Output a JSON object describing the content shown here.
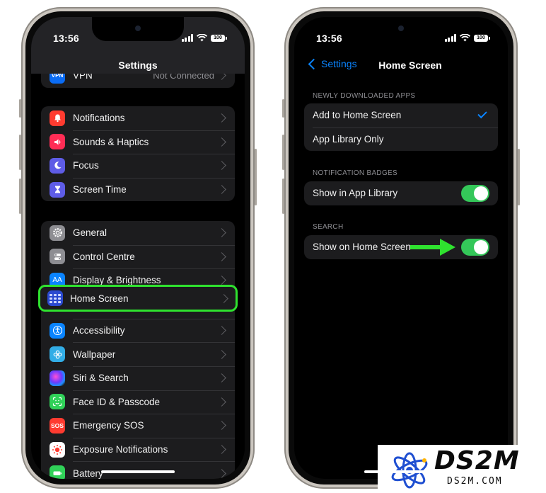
{
  "left_phone": {
    "time": "13:56",
    "battery": "100",
    "title": "Settings",
    "vpn": {
      "label": "VPN",
      "value": "Not Connected"
    },
    "group2": [
      {
        "label": "Notifications",
        "icon": "bell-icon",
        "color": "#ff3b30"
      },
      {
        "label": "Sounds & Haptics",
        "icon": "speaker-icon",
        "color": "#ff2d55"
      },
      {
        "label": "Focus",
        "icon": "moon-icon",
        "color": "#5e5ce6"
      },
      {
        "label": "Screen Time",
        "icon": "hourglass-icon",
        "color": "#5e5ce6"
      }
    ],
    "group3": [
      {
        "label": "General",
        "icon": "gear-icon",
        "color": "#8e8e93"
      },
      {
        "label": "Control Centre",
        "icon": "toggles-icon",
        "color": "#8e8e93"
      },
      {
        "label": "Display & Brightness",
        "icon": "text-size-icon",
        "color": "#0a84ff"
      },
      {
        "label": "Home Screen",
        "icon": "home-grid-icon",
        "color": "#2b4ad0"
      },
      {
        "label": "Accessibility",
        "icon": "accessibility-icon",
        "color": "#0a84ff"
      },
      {
        "label": "Wallpaper",
        "icon": "flower-icon",
        "color": "#32ade6"
      },
      {
        "label": "Siri & Search",
        "icon": "siri-icon",
        "color": "#2c2c2e"
      },
      {
        "label": "Face ID & Passcode",
        "icon": "face-id-icon",
        "color": "#30d158"
      },
      {
        "label": "Emergency SOS",
        "icon": "sos-icon",
        "color": "#ff3b30"
      },
      {
        "label": "Exposure Notifications",
        "icon": "exposure-icon",
        "color": "#ffffff"
      },
      {
        "label": "Battery",
        "icon": "battery-icon",
        "color": "#30d158"
      }
    ],
    "sos_text": "SOS",
    "display_text": "AA"
  },
  "right_phone": {
    "time": "13:56",
    "battery": "100",
    "back_label": "Settings",
    "title": "Home Screen",
    "section1": {
      "header": "NEWLY DOWNLOADED APPS",
      "items": [
        "Add to Home Screen",
        "App Library Only"
      ]
    },
    "section2": {
      "header": "NOTIFICATION BADGES",
      "item": "Show in App Library"
    },
    "section3": {
      "header": "SEARCH",
      "item": "Show on Home Screen"
    }
  },
  "colors": {
    "highlight": "#2fe22f",
    "toggle_on": "#34c759",
    "link": "#0a84ff"
  },
  "watermark": {
    "title": "DS2M",
    "subtitle": "DS2M.COM"
  }
}
